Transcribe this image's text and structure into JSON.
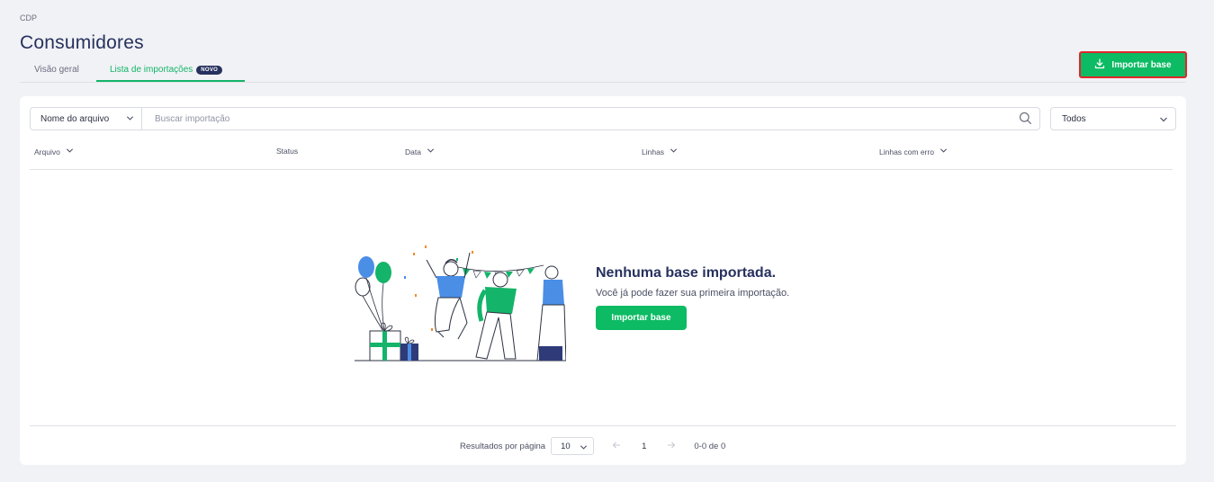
{
  "breadcrumb": "CDP",
  "page": {
    "title": "Consumidores"
  },
  "tabs": [
    {
      "label": "Visão geral",
      "active": false
    },
    {
      "label": "Lista de importações",
      "badge": "NOVO",
      "active": true
    }
  ],
  "header": {
    "import_button_label": "Importar base"
  },
  "filters": {
    "field_select_value": "Nome do arquivo",
    "search_placeholder": "Buscar importação",
    "status_select_value": "Todos"
  },
  "table": {
    "columns": [
      {
        "label": "Arquivo",
        "sortable": true
      },
      {
        "label": "Status",
        "sortable": false
      },
      {
        "label": "Data",
        "sortable": true
      },
      {
        "label": "Linhas",
        "sortable": true
      },
      {
        "label": "Linhas com erro",
        "sortable": true
      }
    ],
    "rows": []
  },
  "empty_state": {
    "title": "Nenhuma base importada.",
    "subtitle": "Você já pode fazer sua primeira importação.",
    "button_label": "Importar base"
  },
  "pagination": {
    "results_per_page_label": "Resultados por página",
    "page_size": "10",
    "current_page": "1",
    "range_text": "0-0 de 0"
  },
  "colors": {
    "accent_green": "#0cbb63",
    "title_navy": "#27315e",
    "highlight_red": "#e0262a",
    "illustration_blue": "#4a8ee6"
  },
  "icons": [
    "download-icon",
    "chevron-down-icon",
    "search-icon",
    "arrow-left-icon",
    "arrow-right-icon"
  ]
}
